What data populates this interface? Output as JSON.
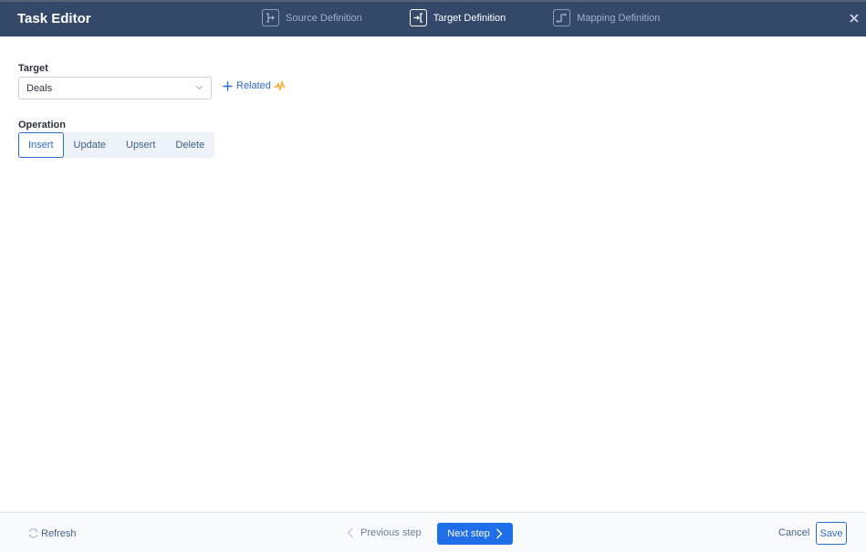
{
  "header": {
    "title": "Task Editor",
    "steps": [
      {
        "label": "Source Definition",
        "icon": "source-definition-icon",
        "active": false
      },
      {
        "label": "Target Definition",
        "icon": "target-definition-icon",
        "active": true
      },
      {
        "label": "Mapping Definition",
        "icon": "mapping-definition-icon",
        "active": false
      }
    ],
    "close_icon": "close-icon"
  },
  "form": {
    "target_label": "Target",
    "target_value": "Deals",
    "related_label": "Related",
    "operation_label": "Operation",
    "operations": [
      {
        "label": "Insert",
        "active": true
      },
      {
        "label": "Update",
        "active": false
      },
      {
        "label": "Upsert",
        "active": false
      },
      {
        "label": "Delete",
        "active": false
      }
    ]
  },
  "footer": {
    "refresh_label": "Refresh",
    "previous_label": "Previous step",
    "next_label": "Next step",
    "cancel_label": "Cancel",
    "save_label": "Save"
  },
  "colors": {
    "header_bg": "#34496a",
    "accent": "#1f6fea",
    "related_pulse": "#f5a623"
  }
}
